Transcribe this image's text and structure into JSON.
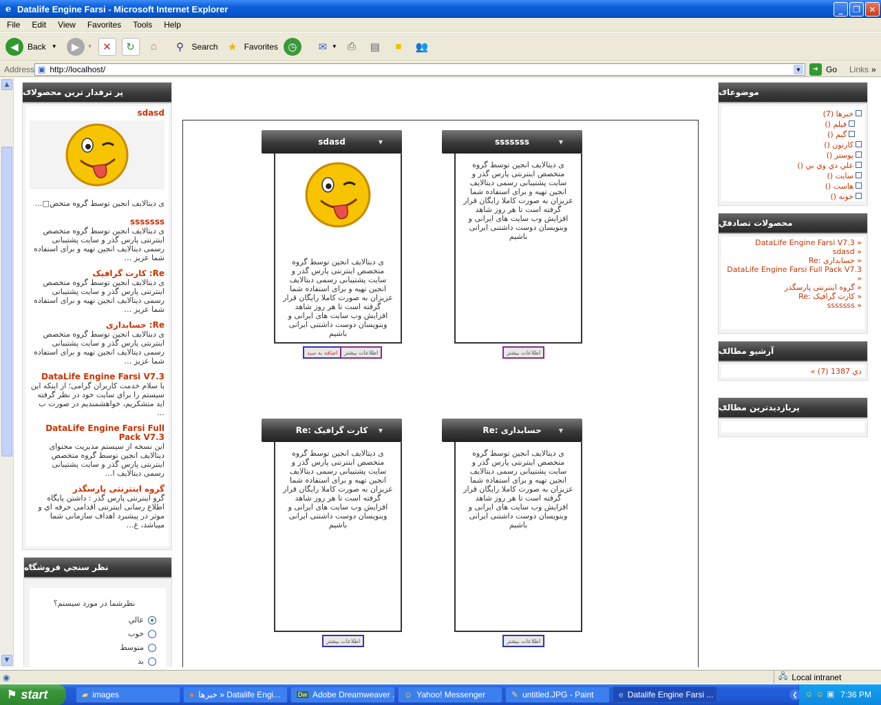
{
  "window": {
    "title": "Datalife Engine Farsi - Microsoft Internet Explorer"
  },
  "menu": [
    "File",
    "Edit",
    "View",
    "Favorites",
    "Tools",
    "Help"
  ],
  "toolbar": {
    "back": "Back",
    "search": "Search",
    "favorites": "Favorites"
  },
  "address": {
    "label": "Address",
    "url": "http://localhost/",
    "go": "Go",
    "links": "Links"
  },
  "left": {
    "top_products": {
      "title": "پر ترفدار ترین محصولات",
      "first_title": "sdasd",
      "first_snippet": "ی دیتالایف انجین توسط گروه متخص□…",
      "items": [
        {
          "title": "sssssss",
          "text": "ی دیتالایف انجین توسط گروه متخصص اینترنتی پارس گذر و سایت پشتیبانی رسمی دیتالایف انجین تهیه و برای استفاده شما عزیز …"
        },
        {
          "title": "Re: کارت گرافیک",
          "text": "ی دیتالایف انجین توسط گروه متخصص اینترنتی پارس گذر و سایت پشتیبانی رسمی دیتالایف انجین تهیه و برای استفاده شما عزیز …"
        },
        {
          "title": "Re: حسابداری",
          "text": "ی دیتالایف انجین توسط گروه متخصص اینترنتی پارس گذر و سایت پشتیبانی رسمی دیتالایف انجین تهیه و برای استفاده شما عزیز …"
        },
        {
          "title": "DataLife Engine Farsi V7.3",
          "text": "با سلام خدمت کاربران گرامی؛ از اینکه این سیستم را براي سایت خود در نظر گرفته اید متشکریم، خواهشمندیم در صورت ب …"
        },
        {
          "title": "DataLife Engine Farsi Full Pack V7.3",
          "text": "این نسخه از سیستم مدیریت محتوای دیتالایف انجین توسط گروه متخصص اینترنتی پارس گذر و سایت پشتیبانی رسمی دیتالایف ا…"
        },
        {
          "title": "گروه اینترنتی پارسگذر",
          "text": "گرو اینترنتی پارس گذر : داشتن پایگاه اطلاع رسانی اینترنتی اقدامی حرفه اي و موثر در پیشبرد اهداف سازمانی شما میباشد، غ…"
        }
      ]
    },
    "poll": {
      "title": "نظر سنجي فروشگاه",
      "question": "نظرشما در مورد سیستم؟",
      "options": [
        "عالي",
        "خوب",
        "متوسط",
        "بد"
      ],
      "selected": 0
    }
  },
  "articles": [
    {
      "title": "sssssss",
      "text": "ی دیتالایف انجین توسط گروه متخصص اینترنتی پارس گذر و سایت پشتیبانی رسمی دیتالایف انجین تهیه و برای استفاده شما عزیزان به صورت کاملا رایگان قرار گرفته است تا هر روز شاهد افزایش وب سایت های ایرانی و وبنویسان دوست داشتنی ایرانی باشیم",
      "more": "اطلاعات بیشتر"
    },
    {
      "title": "sdasd",
      "text": "ی دیتالایف انجین توسط گروه متخصص اینترنتی پارس گذر و سایت پشتیبانی رسمی دیتالایف انجین تهیه و برای استفاده شما عزیزان به صورت کاملا رایگان قرار گرفته است تا هر روز شاهد افزایش وب سایت های ایرانی و وبنویسان دوست داشتنی ایرانی باشیم",
      "more": "اطلاعات بیشتر",
      "cart": "اضافه به سبد"
    },
    {
      "title": "Re: حسابداری",
      "text": "ی دیتالایف انجین توسط گروه متخصص اینترنتی پارس گذر و سایت پشتیبانی رسمی دیتالایف انجین تهیه و برای استفاده شما عزیزان به صورت کاملا رایگان قرار گرفته است تا هر روز شاهد افزایش وب سایت های ایرانی و وبنویسان دوست داشتنی ایرانی باشیم",
      "more": "اطلاعات بیشتر"
    },
    {
      "title": "Re: کارت گرافیک",
      "text": "ی دیتالایف انجین توسط گروه متخصص اینترنتی پارس گذر و سایت پشتیبانی رسمی دیتالایف انجین تهیه و برای استفاده شما عزیزان به صورت کاملا رایگان قرار گرفته است تا هر روز شاهد افزایش وب سایت های ایرانی و وبنویسان دوست داشتنی ایرانی باشیم",
      "more": "اطلاعات بیشتر"
    }
  ],
  "right": {
    "topics": {
      "title": "موضوعات",
      "items": [
        "خبرها (7)",
        "فیلم ()",
        "گیم ()",
        "کارتون ()",
        "پوستر ()",
        "علي دي وي بي ()",
        "سایت ()",
        "هاست ()",
        "خونه ()"
      ]
    },
    "random": {
      "title": "محصولات تصادفي",
      "items": [
        "DataLife Engine Farsi V7.3 »",
        "sdasd »",
        "Re: حسابداری »",
        "DataLife Engine Farsi Full Pack V7.3 »",
        "گروه اینترنتی پارسگذر »",
        "Re: کارت گرافیک »",
        "sssssss »"
      ]
    },
    "archive": {
      "title": "آرشیو مطالب",
      "items": [
        "دي 1387 (7) »"
      ]
    },
    "popular": {
      "title": "پربازدیدترین مطالب"
    }
  },
  "status": {
    "zone": "Local intranet"
  },
  "taskbar": {
    "start": "start",
    "tasks": [
      "images",
      "خبرها » Datalife Engi...",
      "Adobe Dreamweaver ...",
      "Yahoo! Messenger",
      "untitled.JPG - Paint",
      "Datalife Engine Farsi ..."
    ],
    "time": "7:36 PM"
  }
}
